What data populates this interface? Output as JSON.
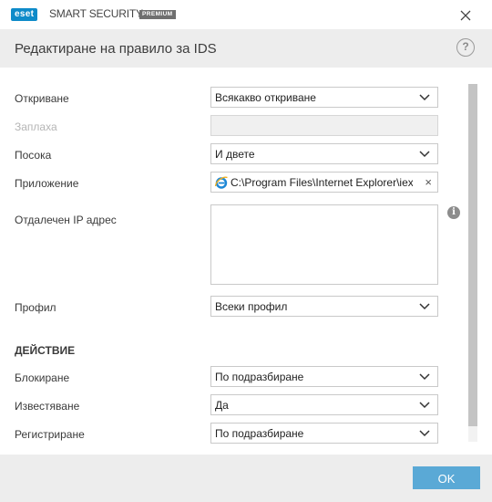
{
  "window": {
    "logo_text": "eset",
    "product_name": "SMART SECURITY",
    "edition": "PREMIUM"
  },
  "dialog": {
    "title": "Редактиране на правило за IDS",
    "help_label": "?"
  },
  "form": {
    "detection": {
      "label": "Откриване",
      "value": "Всякакво откриване"
    },
    "threat": {
      "label": "Заплаха",
      "value": ""
    },
    "direction": {
      "label": "Посока",
      "value": "И двете"
    },
    "application": {
      "label": "Приложение",
      "value": "C:\\Program Files\\Internet Explorer\\iexplore.exe"
    },
    "remote_ip": {
      "label": "Отдалечен IP адрес",
      "value": ""
    },
    "profile": {
      "label": "Профил",
      "value": "Всеки профил"
    }
  },
  "action": {
    "heading": "ДЕЙСТВИЕ",
    "block": {
      "label": "Блокиране",
      "value": "По подразбиране"
    },
    "notify": {
      "label": "Известяване",
      "value": "Да"
    },
    "log": {
      "label": "Регистриране",
      "value": "По подразбиране"
    }
  },
  "footer": {
    "ok_label": "OK"
  },
  "colors": {
    "brand": "#0e8bc9",
    "ok_button": "#5aa9d6",
    "header_bg": "#ededed"
  },
  "icons": [
    "close-icon",
    "help-icon",
    "chevron-down-icon",
    "info-icon",
    "internet-explorer-icon",
    "clear-icon"
  ]
}
